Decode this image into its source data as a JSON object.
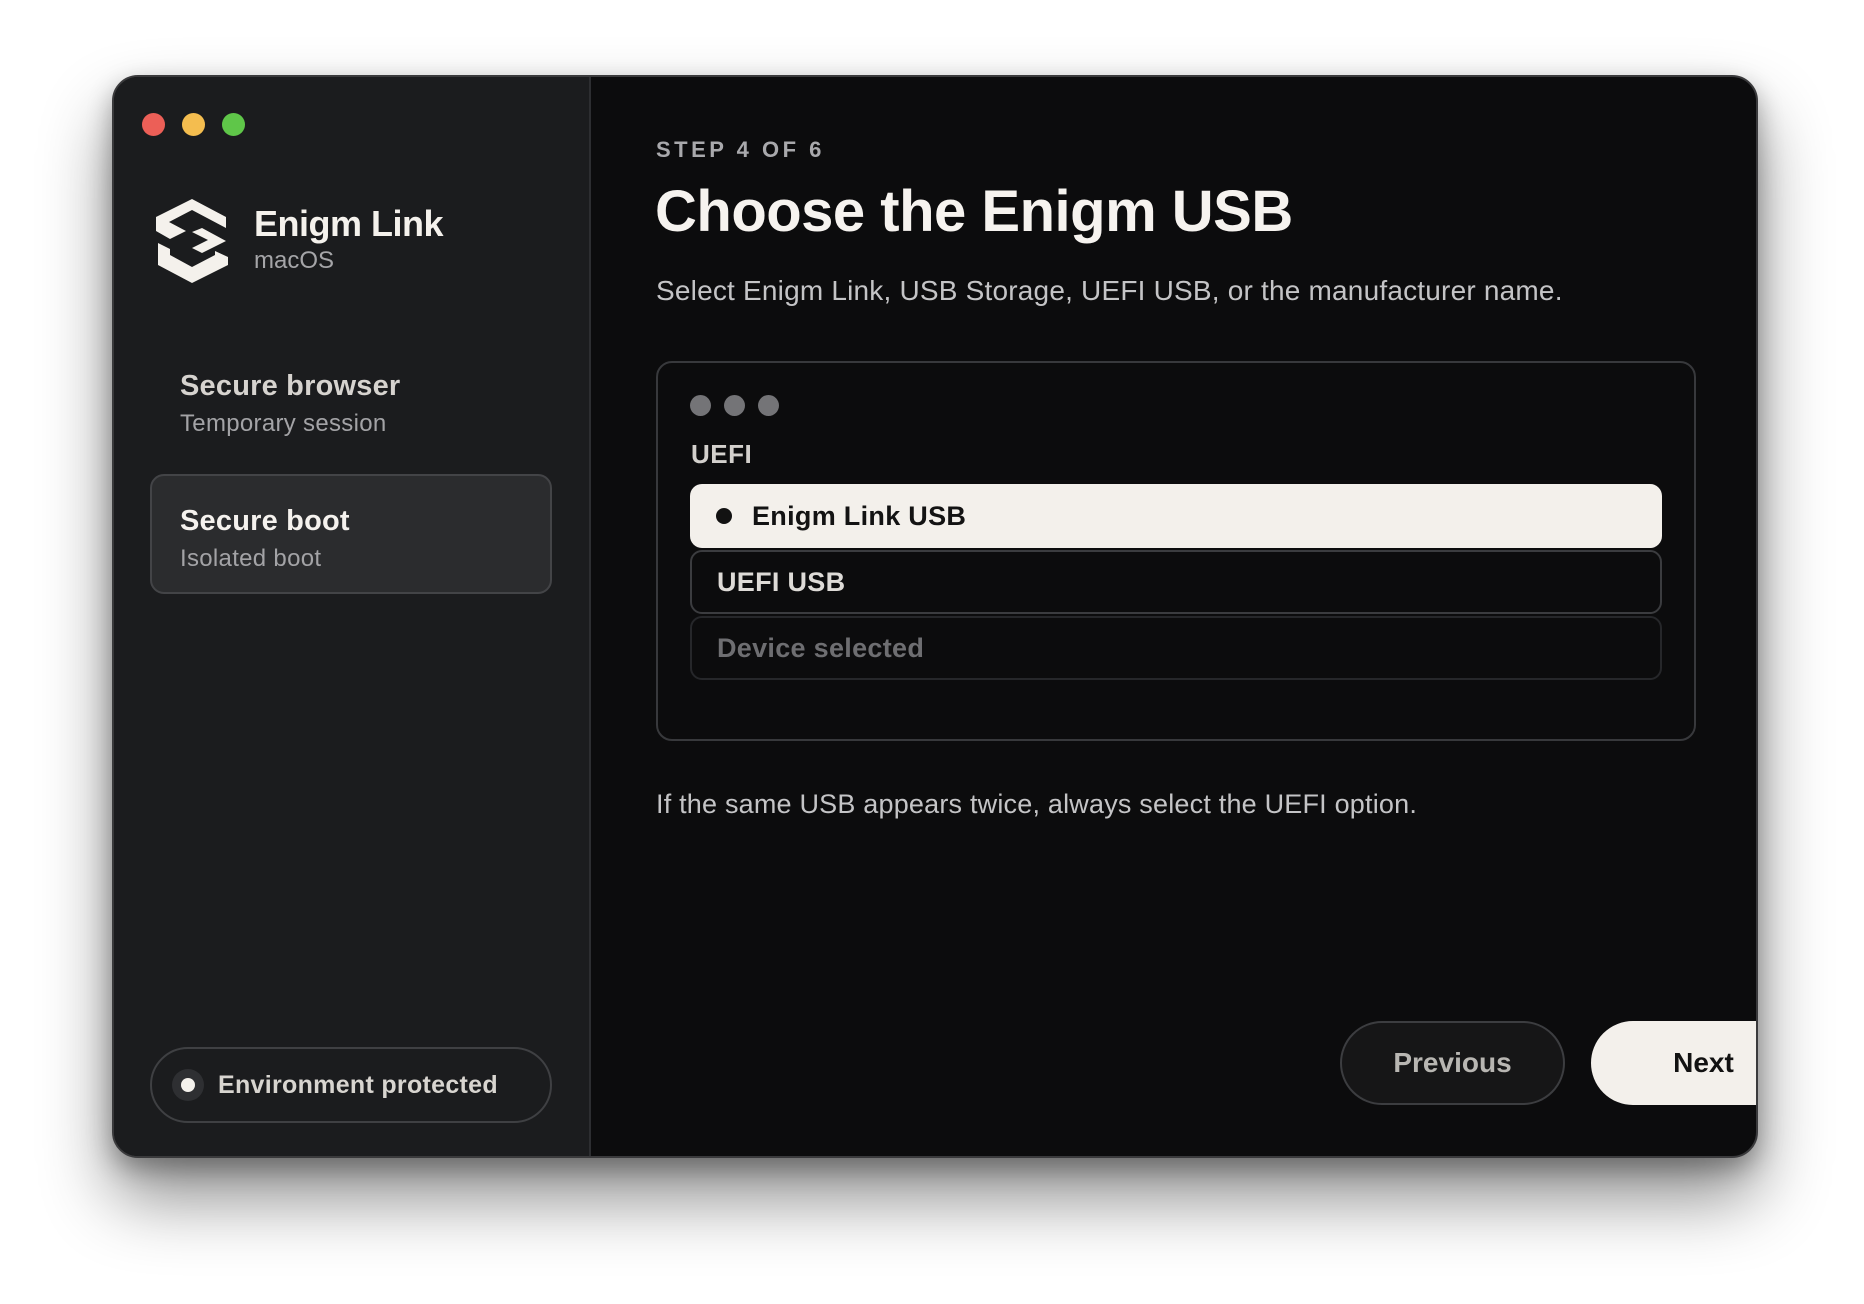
{
  "window_controls": {
    "close_color": "#ec5f57",
    "minimize_color": "#f4bd4f",
    "zoom_color": "#5fc649"
  },
  "brand": {
    "logo_icon": "enigm-logo-icon",
    "title": "Enigm Link",
    "platform": "macOS"
  },
  "sidebar": {
    "items": [
      {
        "title": "Secure browser",
        "subtitle": "Temporary session",
        "active": false
      },
      {
        "title": "Secure boot",
        "subtitle": "Isolated boot",
        "active": true
      }
    ],
    "status": {
      "label": "Environment protected"
    }
  },
  "main": {
    "step": "STEP 4 OF 6",
    "title": "Choose the Enigm USB",
    "subtitle": "Select Enigm Link, USB Storage, UEFI USB, or the manufacturer name.",
    "picker": {
      "group_label": "UEFI",
      "options": [
        {
          "label": "Enigm Link USB",
          "state": "selected"
        },
        {
          "label": "UEFI USB",
          "state": "normal"
        },
        {
          "label": "Device selected",
          "state": "disabled"
        }
      ]
    },
    "note": "If the same USB appears twice, always select the UEFI option."
  },
  "footer": {
    "previous_label": "Previous",
    "next_label": "Next"
  },
  "colors": {
    "accent_light": "#f3f0eb",
    "sidebar_bg": "#1b1c1e",
    "main_bg": "#0c0c0d"
  }
}
